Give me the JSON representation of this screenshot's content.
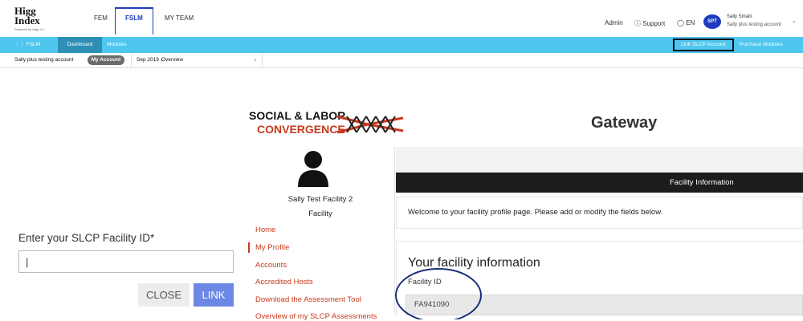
{
  "topnav": {
    "logo_main": "Higg Index",
    "logo_sub": "Powered by Higg Co",
    "tabs": [
      "FEM",
      "FSLM",
      "MY TEAM"
    ],
    "active_tab": "FSLM",
    "admin": "Admin",
    "support": "Support",
    "language": "EN",
    "avatar_initials": "SPT",
    "user_name": "Sally Smaili",
    "user_account": "Sally plus testing account"
  },
  "module_bar": {
    "module_name": "FSLM",
    "dashboard": "Dashboard",
    "modules": "Modules",
    "link_slcp": "Link SLCP Account",
    "purchase": "Purchase Modules",
    "accent_color": "#4ec6ee"
  },
  "sub_bar": {
    "account_name": "Sally plus testing account",
    "my_account": "My Account",
    "period": "Sep 2019",
    "view": "Overview"
  },
  "link_dialog": {
    "label": "Enter your SLCP Facility ID*",
    "input_value": "|",
    "close_label": "CLOSE",
    "link_label": "LINK"
  },
  "gateway": {
    "logo_line1": "SOCIAL & LABOR",
    "logo_line2": "CONVERGENCE",
    "title": "Gateway",
    "facility_name": "Sally Test Facility 2",
    "facility_type": "Facility",
    "menu": [
      "Home",
      "My Profile",
      "Accounts",
      "Accredited Hosts",
      "Download the Assessment Tool",
      "Overview of my SLCP Assessments"
    ],
    "active_menu": "My Profile",
    "section_bar": "Facility Information",
    "welcome": "Welcome to your facility profile page. Please add or modify the fields below.",
    "info_title": "Your facility information",
    "facility_id_label": "Facility ID",
    "facility_id_value": "FA941090",
    "brand_color": "#c8391c"
  }
}
